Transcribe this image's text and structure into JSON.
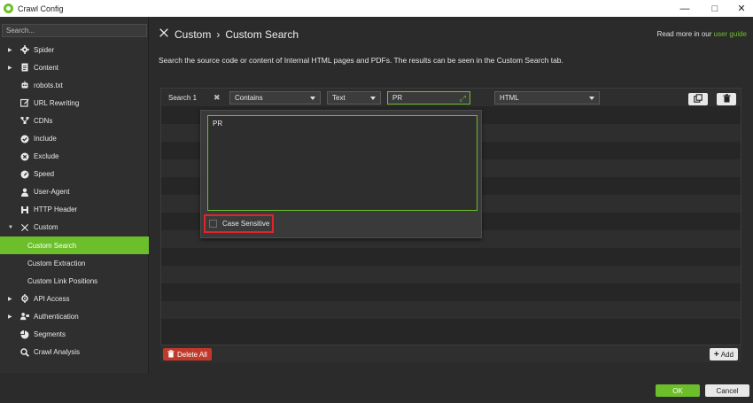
{
  "window": {
    "title": "Crawl Config"
  },
  "sidebar": {
    "search_placeholder": "Search...",
    "items": [
      {
        "label": "Spider",
        "icon": "gear-icon",
        "arrow": "▶"
      },
      {
        "label": "Content",
        "icon": "document-icon",
        "arrow": "▶"
      },
      {
        "label": "robots.txt",
        "icon": "robot-icon",
        "arrow": ""
      },
      {
        "label": "URL Rewriting",
        "icon": "edit-icon",
        "arrow": ""
      },
      {
        "label": "CDNs",
        "icon": "network-icon",
        "arrow": ""
      },
      {
        "label": "Include",
        "icon": "check-circle-icon",
        "arrow": ""
      },
      {
        "label": "Exclude",
        "icon": "x-circle-icon",
        "arrow": ""
      },
      {
        "label": "Speed",
        "icon": "speedometer-icon",
        "arrow": ""
      },
      {
        "label": "User-Agent",
        "icon": "user-icon",
        "arrow": ""
      },
      {
        "label": "HTTP Header",
        "icon": "header-icon",
        "arrow": ""
      },
      {
        "label": "Custom",
        "icon": "tools-icon",
        "arrow": "▼"
      },
      {
        "label": "Custom Search",
        "sub": true,
        "active": true
      },
      {
        "label": "Custom Extraction",
        "sub": true
      },
      {
        "label": "Custom Link Positions",
        "sub": true
      },
      {
        "label": "API Access",
        "icon": "api-icon",
        "arrow": "▶"
      },
      {
        "label": "Authentication",
        "icon": "users-icon",
        "arrow": "▶"
      },
      {
        "label": "Segments",
        "icon": "pie-icon",
        "arrow": ""
      },
      {
        "label": "Crawl Analysis",
        "icon": "magnifier-icon",
        "arrow": ""
      }
    ]
  },
  "main": {
    "breadcrumb_root": "Custom",
    "breadcrumb_sep": "›",
    "breadcrumb_page": "Custom Search",
    "guide_prefix": "Read more in our",
    "guide_link": "user guide",
    "description": "Search the source code or content of Internal HTML pages and PDFs. The results can be seen in the Custom Search tab.",
    "row": {
      "name": "Search 1",
      "mode": "Contains",
      "type": "Text",
      "value": "PR",
      "scope": "HTML"
    },
    "popup": {
      "text": "PR",
      "case_label": "Case Sensitive",
      "case_checked": false
    },
    "delete_all": "Delete All",
    "add": "Add"
  },
  "footer": {
    "ok": "OK",
    "cancel": "Cancel"
  },
  "colors": {
    "accent": "#6cbf2a",
    "danger": "#c0392b",
    "highlight": "#e1242b"
  }
}
